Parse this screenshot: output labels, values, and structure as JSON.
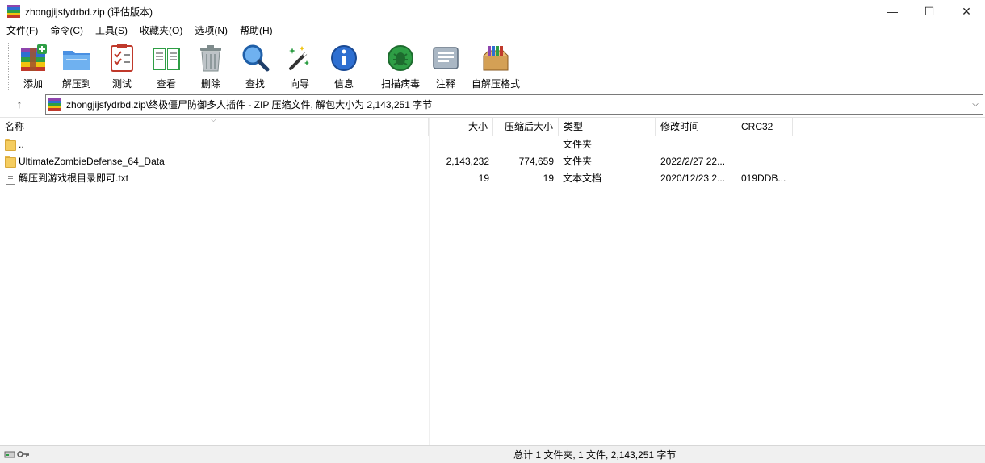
{
  "window": {
    "title": "zhongjijsfydrbd.zip (评估版本)",
    "minimize_glyph": "—",
    "maximize_glyph": "☐",
    "close_glyph": "✕"
  },
  "menu": [
    "文件(F)",
    "命令(C)",
    "工具(S)",
    "收藏夹(O)",
    "选项(N)",
    "帮助(H)"
  ],
  "toolbar": {
    "add": "添加",
    "extract_to": "解压到",
    "test": "测试",
    "view": "查看",
    "delete": "删除",
    "find": "查找",
    "wizard": "向导",
    "info": "信息",
    "virus_scan": "扫描病毒",
    "comment": "注释",
    "sfx": "自解压格式"
  },
  "address": {
    "up_glyph": "↑",
    "path": "zhongjijsfydrbd.zip\\终极僵尸防御多人插件 - ZIP 压缩文件, 解包大小为 2,143,251 字节",
    "drop_glyph": "⌵"
  },
  "columns": {
    "name": "名称",
    "size": "大小",
    "packed": "压缩后大小",
    "type": "类型",
    "modified": "修改时间",
    "crc": "CRC32"
  },
  "rows": [
    {
      "name": "..",
      "size": "",
      "packed": "",
      "type": "文件夹",
      "modified": "",
      "crc": ""
    },
    {
      "name": "UltimateZombieDefense_64_Data",
      "size": "2,143,232",
      "packed": "774,659",
      "type": "文件夹",
      "modified": "2022/2/27 22...",
      "crc": ""
    },
    {
      "name": "解压到游戏根目录即可.txt",
      "size": "19",
      "packed": "19",
      "type": "文本文档",
      "modified": "2020/12/23 2...",
      "crc": "019DDB..."
    }
  ],
  "status": {
    "summary": "总计 1 文件夹, 1 文件, 2,143,251 字节"
  },
  "colors": {
    "rar_red": "#c0392b",
    "rar_yellow": "#f1c40f",
    "rar_blue": "#2e6fd1",
    "rar_green": "#2e9e45",
    "rar_purple": "#8e44ad"
  }
}
